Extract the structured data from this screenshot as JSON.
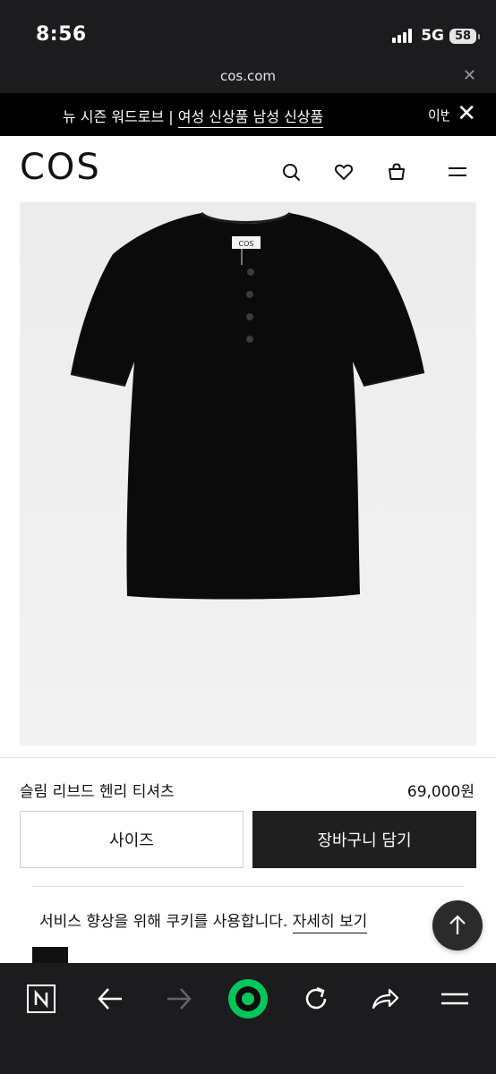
{
  "status": {
    "time": "8:56",
    "network": "5G",
    "battery": "58"
  },
  "browser": {
    "url": "cos.com",
    "close_icon": "close-icon"
  },
  "promo": {
    "prefix": "뉴 시즌 워드로브 | ",
    "link": "여성 신상품 남성 신상품",
    "more": "이번",
    "close_icon": "close-icon"
  },
  "header": {
    "logo": "COS",
    "icons": [
      "search-icon",
      "heart-icon",
      "bag-icon",
      "menu-icon"
    ]
  },
  "product": {
    "name": "슬림 리브드 헨리 티셔츠",
    "price": "69,000원",
    "size_button": "사이즈",
    "cart_button": "장바구니 담기",
    "tag_label": "COS"
  },
  "cookie": {
    "text": "서비스 향상을 위해 쿠키를 사용합니다. ",
    "link": "자세히 보기"
  },
  "browser_toolbar": {
    "icons": [
      "naver-icon",
      "back-arrow-icon",
      "forward-arrow-icon",
      "green-dot-icon",
      "refresh-icon",
      "share-icon",
      "menu-icon"
    ]
  },
  "colors": {
    "brand_black": "#000000",
    "toolbar_bg": "#1c1c1e",
    "accent_green": "#03c75a",
    "image_bg": "#ededed"
  }
}
